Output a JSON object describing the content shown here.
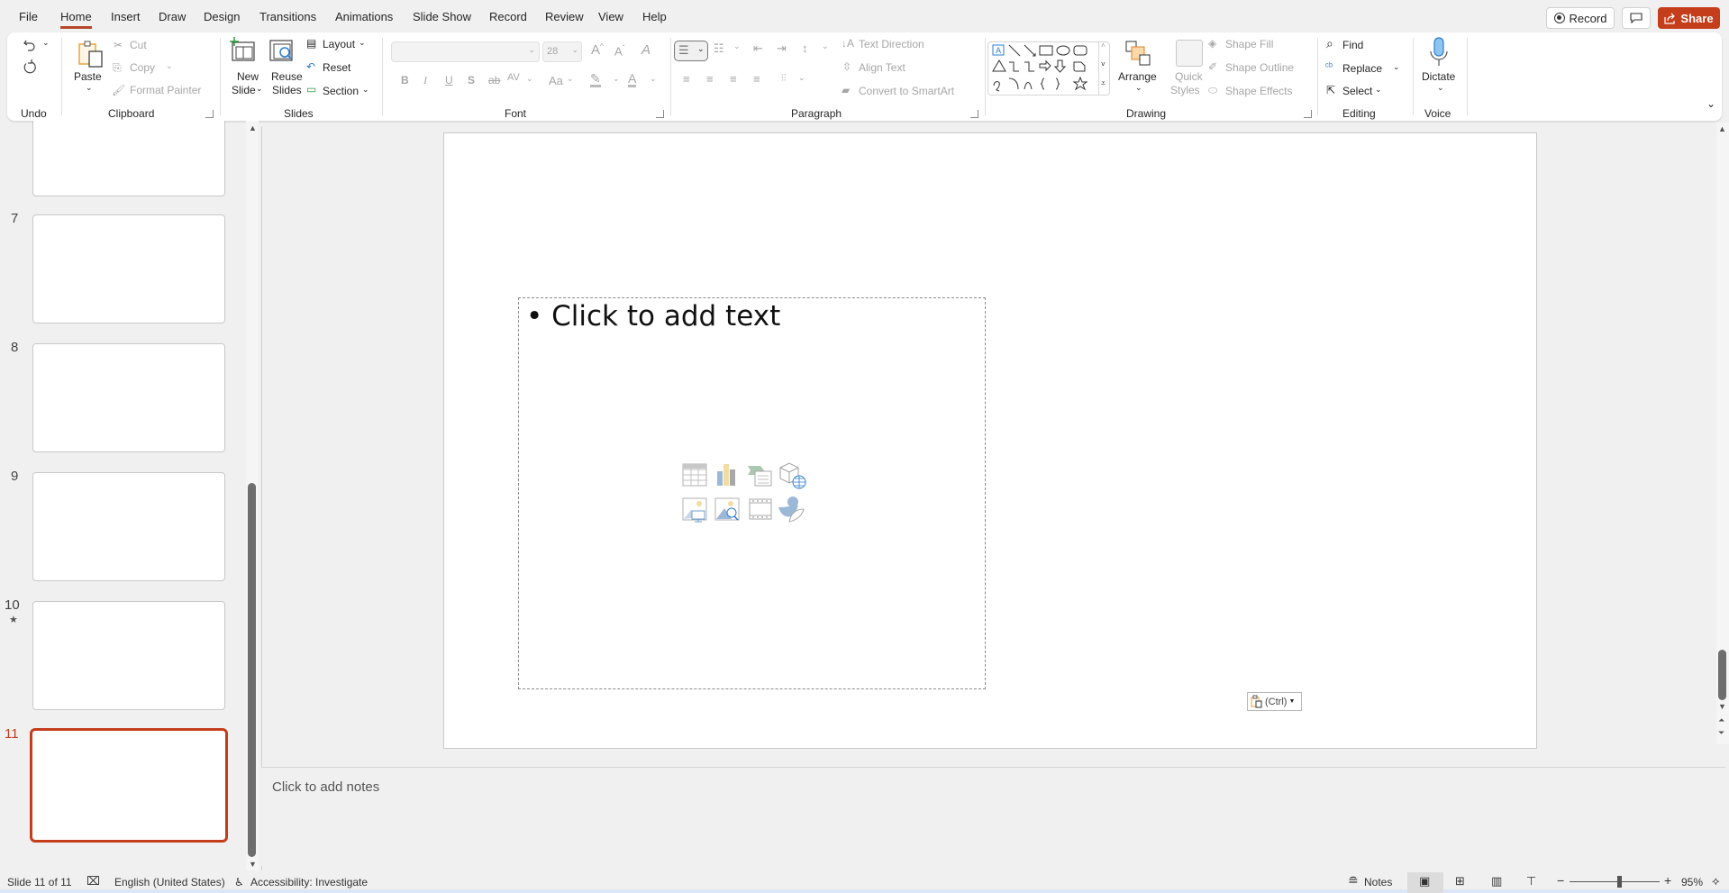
{
  "menu": {
    "tabs": [
      "File",
      "Home",
      "Insert",
      "Draw",
      "Design",
      "Transitions",
      "Animations",
      "Slide Show",
      "Record",
      "Review",
      "View",
      "Help"
    ],
    "active_tab": "Home",
    "record_label": "Record",
    "share_label": "Share"
  },
  "ribbon": {
    "undo": {
      "group_label": "Undo"
    },
    "clipboard": {
      "paste": "Paste",
      "cut": "Cut",
      "copy": "Copy",
      "format_painter": "Format Painter",
      "group_label": "Clipboard"
    },
    "slides": {
      "new_slide_line1": "New",
      "new_slide_line2": "Slide",
      "reuse_line1": "Reuse",
      "reuse_line2": "Slides",
      "layout": "Layout",
      "reset": "Reset",
      "section": "Section",
      "group_label": "Slides"
    },
    "font": {
      "font_name": "",
      "font_size": "28",
      "bold": "B",
      "italic": "I",
      "underline": "U",
      "shadow": "S",
      "strike": "ab",
      "spacing": "AV",
      "case": "Aa",
      "group_label": "Font"
    },
    "paragraph": {
      "text_direction": "Text Direction",
      "align_text": "Align Text",
      "convert_smartart": "Convert to SmartArt",
      "group_label": "Paragraph"
    },
    "drawing": {
      "arrange": "Arrange",
      "quick_line1": "Quick",
      "quick_line2": "Styles",
      "shape_fill": "Shape Fill",
      "shape_outline": "Shape Outline",
      "shape_effects": "Shape Effects",
      "group_label": "Drawing"
    },
    "editing": {
      "find": "Find",
      "replace": "Replace",
      "select": "Select",
      "group_label": "Editing"
    },
    "voice": {
      "dictate": "Dictate",
      "group_label": "Voice"
    }
  },
  "thumbnails": [
    {
      "number": "",
      "selected": false
    },
    {
      "number": "7",
      "selected": false
    },
    {
      "number": "8",
      "selected": false
    },
    {
      "number": "9",
      "selected": false
    },
    {
      "number": "10",
      "selected": false,
      "has_animation": true
    },
    {
      "number": "11",
      "selected": true
    }
  ],
  "slide": {
    "placeholder_text": "Click to add text",
    "paste_options": "(Ctrl)"
  },
  "notes": {
    "placeholder": "Click to add notes"
  },
  "status": {
    "slide_counter": "Slide 11 of 11",
    "language": "English (United States)",
    "accessibility": "Accessibility: Investigate",
    "notes_label": "Notes",
    "zoom_level": "95%",
    "zoom_fraction": 0.55
  },
  "colors": {
    "accent": "#c43e1c",
    "tab_underline": "#b7472a"
  }
}
